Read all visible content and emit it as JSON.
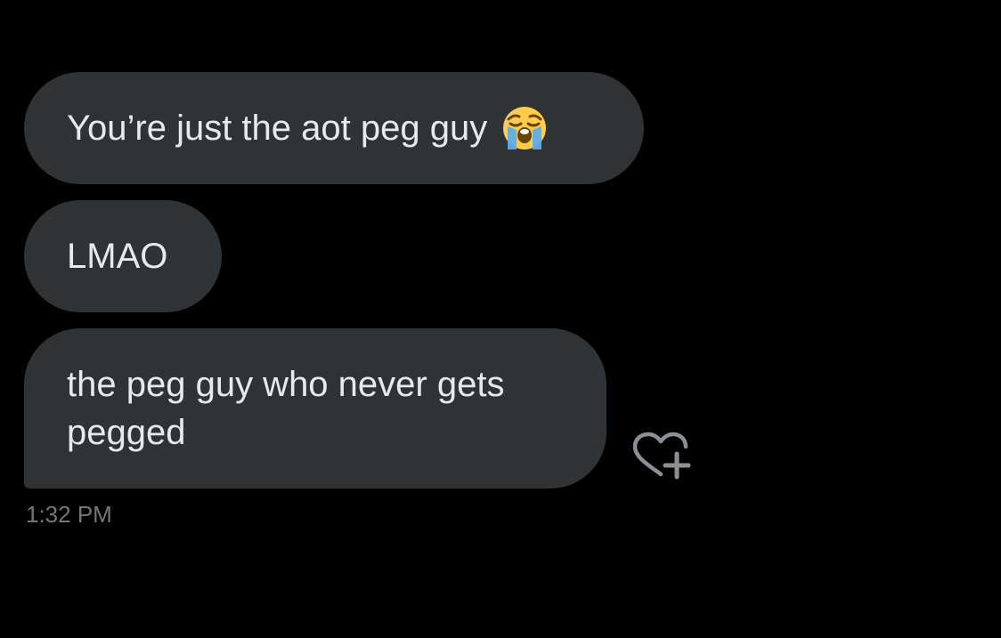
{
  "messages": [
    {
      "text": "You’re just the aot peg guy",
      "emoji": "loudly-crying-face-emoji"
    },
    {
      "text": "LMAO"
    },
    {
      "text": "the peg guy who never gets pegged"
    }
  ],
  "timestamp": "1:32 PM",
  "icons": {
    "react": "heart-plus-icon"
  },
  "colors": {
    "background": "#000000",
    "bubble": "#2f3336",
    "text": "#e7e9ea",
    "muted": "#71767b"
  }
}
